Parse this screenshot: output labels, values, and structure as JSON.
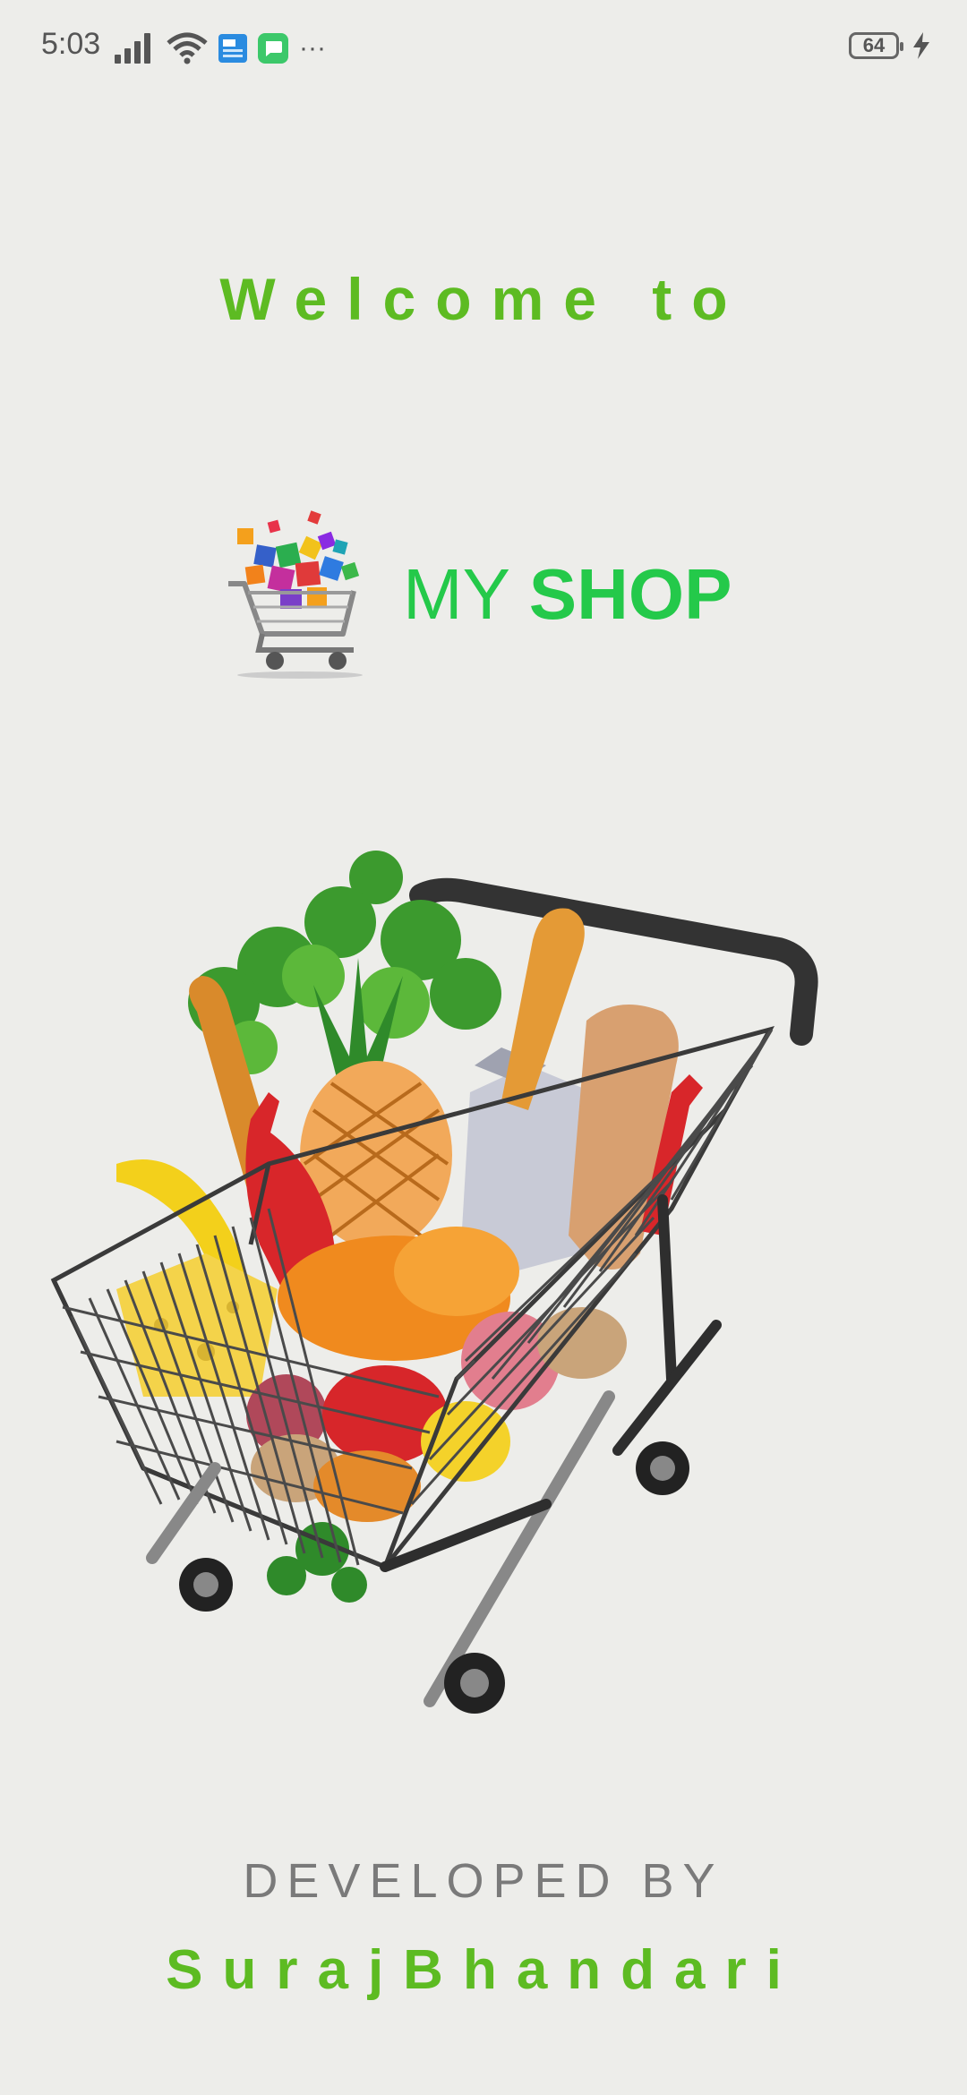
{
  "status_bar": {
    "time": "5:03",
    "battery": "64",
    "overflow": "···"
  },
  "welcome_text": "Welcome to",
  "logo": {
    "text_regular": "MY ",
    "text_bold": "SHOP",
    "color": "#24C94A"
  },
  "footer": {
    "developed_by": "DEVELOPED BY",
    "developer_name": "SurajBhandari"
  },
  "colors": {
    "accent_green": "#5DBB22",
    "background": "#EDEDEA",
    "muted_text": "#7A7A7A"
  }
}
